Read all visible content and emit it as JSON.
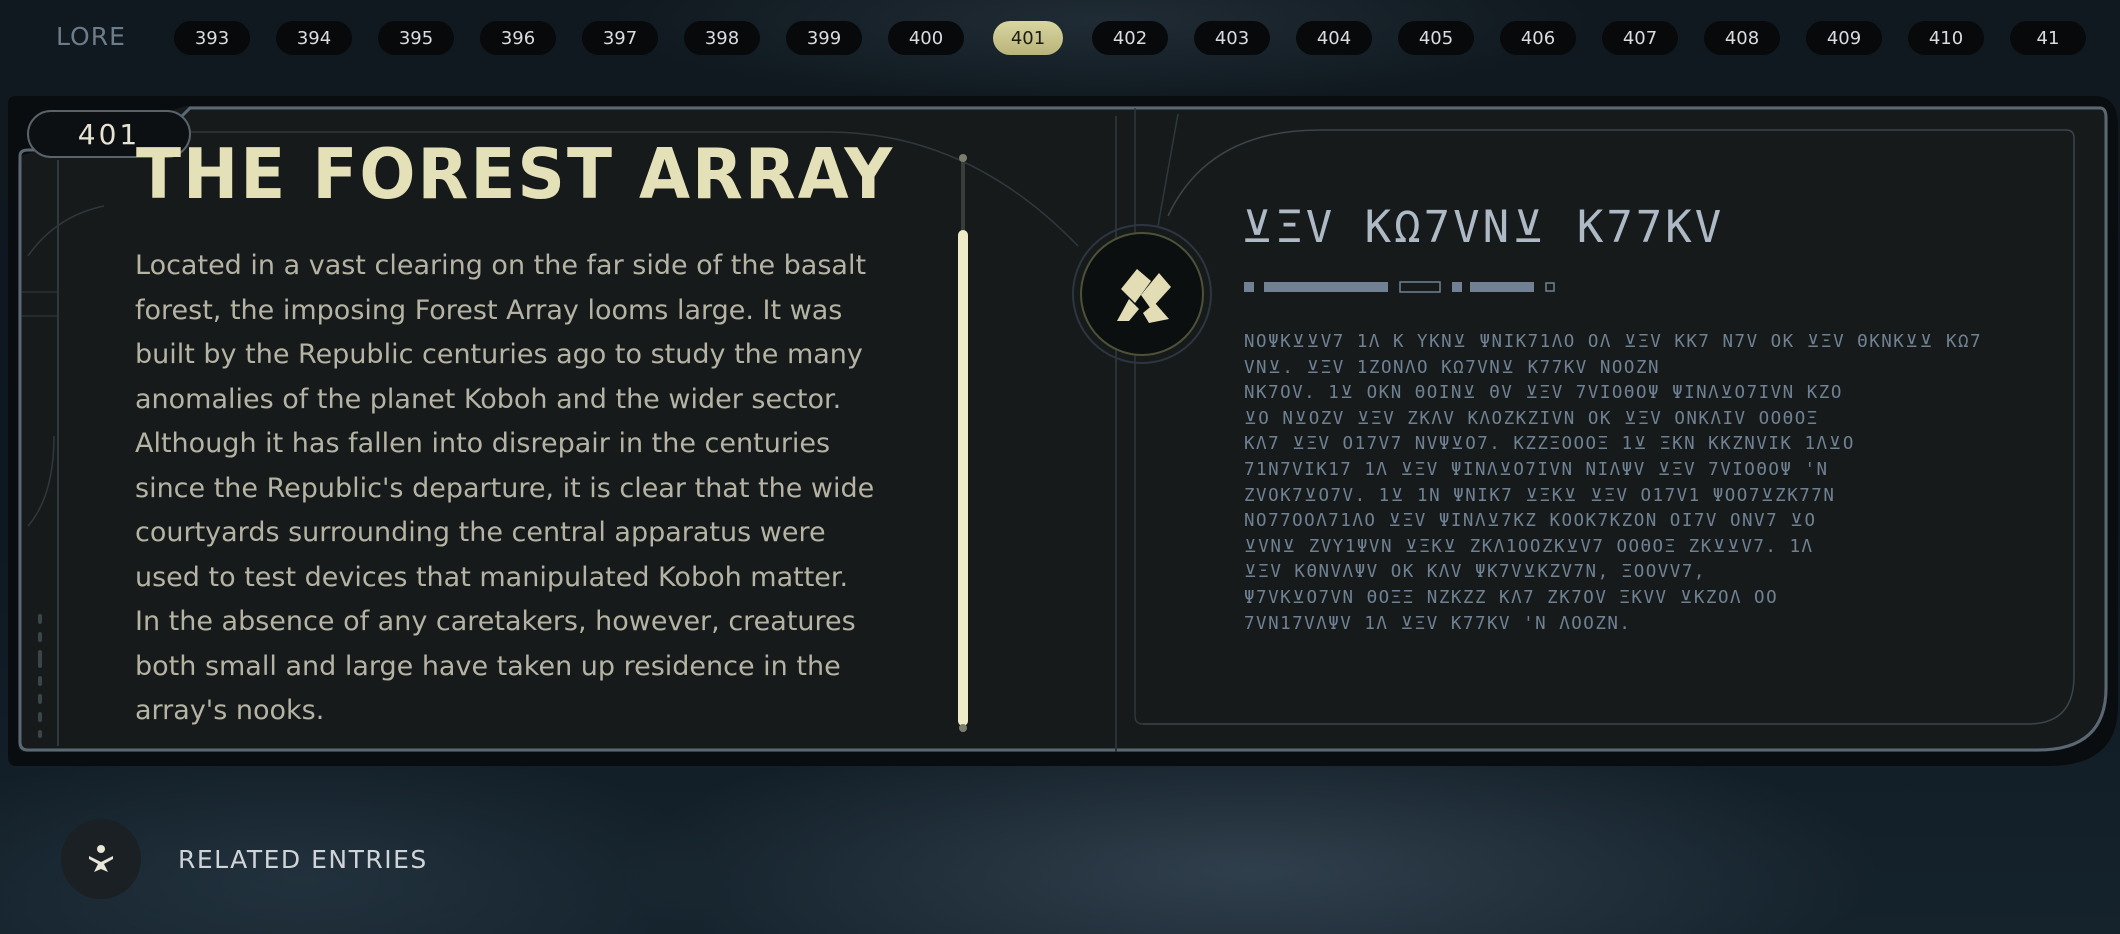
{
  "nav": {
    "section_label": "LORE",
    "entries": [
      "393",
      "394",
      "395",
      "396",
      "397",
      "398",
      "399",
      "400",
      "401",
      "402",
      "403",
      "404",
      "405",
      "406",
      "407",
      "408",
      "409",
      "410",
      "41"
    ],
    "active_entry": "401"
  },
  "entry": {
    "number": "401",
    "title": "THE FOREST ARRAY",
    "body": "Located in a vast clearing on the far side of the basalt forest, the imposing Forest Array looms large. It was built by the Republic centuries ago to study the many anomalies of the planet Koboh and the wider sector. Although it has fallen into disrepair in the centuries since the Republic's departure, it is clear that the wide courtyards surrounding the central apparatus were used to test devices that manipulated Koboh matter. In the absence of any caretakers, however, creatures both small and large have taken up residence in the array's nooks.",
    "aurebesh_title": "⊻ΞV ΚΩ7VΝ⊻ Κ77ΚV",
    "aurebesh_body": "ΝΟΨΚ⊻⊻V7 1Λ Κ ΥΚΝ⊻ ΨΝΙΚ71ΛΟ ΟΛ ⊻ΞV ΚΚ7 Ν7V ΟΚ ⊻ΞV ΘΚΝΚ⊻⊻ ΚΩ7VΝ⊻. ⊻ΞV 1ΖΟΝΛΟ ΚΩ7VΝ⊻ Κ77ΚV ΝΟΟΖΝ\nΝΚ7ΟV. 1⊻ ΟΚΝ ΘΟΙΝ⊻ ΘV ⊻ΞV 7VΙΟΘΟΨ ΨΙΝΛ⊻Ο7ΙVΝ ΚΖΟ\n⊻Ο Ν⊻ΟΖV ⊻ΞV ΖΚΛV ΚΛΟΖΚΖΙVΝ ΟΚ ⊻ΞV ΟΝΚΛΙV ΟΟΘΟΞ\nΚΛ7 ⊻ΞV Ο17V7 ΝVΨ⊻Ο7. ΚΖΖΞΟΟΟΞ 1⊻ ΞΚΝ ΚΚΖΝVΙΚ 1Λ⊻Ο\n71Ν7VΙΚ17 1Λ ⊻ΞV ΨΙΝΛ⊻Ο7ΙVΝ ΝΙΛΨV ⊻ΞV 7VΙΟΘΟΨ 'Ν\nΖVΟΚ7⊻Ο7V. 1⊻ 1Ν ΨΝΙΚ7 ⊻ΞΚ⊻ ⊻ΞV Ο17V1 ΨΟΟ7⊻ΖΚ77Ν\nΝΟ77ΟΟΛ71ΛΟ ⊻ΞV ΨΙΝΛ⊻7ΚΖ ΚΟΟΚ7ΚΖΟΝ ΟΙ7V ΟΝV7 ⊻Ο\n⊻VΝ⊻ ΖVΥ1ΨVΝ ⊻ΞΚ⊻ ΖΚΛ1ΟΟΖΚ⊻V7 ΟΟΘΟΞ ΖΚ⊻⊻V7. 1Λ\n⊻ΞV ΚΘΝVΛΨV ΟΚ ΚΛV ΨΚ7V⊻ΚΖV7Ν, ΞΟΟVV7,\nΨ7VΚ⊻Ο7VΝ ΘΟΞΞ ΝΖΚΖΖ ΚΛ7 ΖΚ7ΟV ΞΚVV ⊻ΚΖΟΛ ΟΟ\n7VΝ17VΛΨV 1Λ ⊻ΞV Κ77ΚV 'Ν ΛΟΟΖΝ."
  },
  "related": {
    "label": "RELATED ENTRIES"
  },
  "colors": {
    "accent": "#d9d6a0",
    "title": "#e4e0b8",
    "body_text": "#b5b3a3",
    "aurebesh": "#6f8193",
    "panel_border": "#5a6874"
  },
  "icons": {
    "emblem": "koboh-matter-emblem-icon",
    "related": "meditation-figure-icon"
  }
}
